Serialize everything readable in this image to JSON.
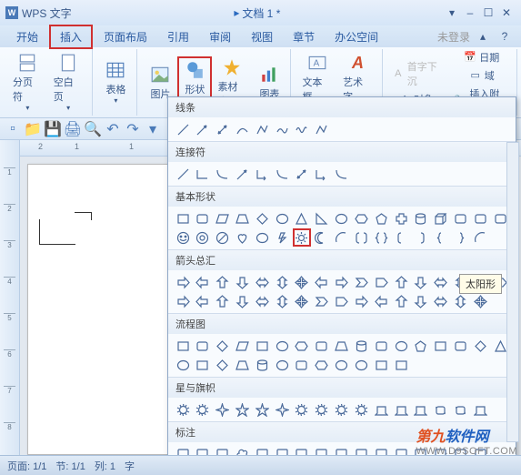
{
  "app": {
    "name": "WPS 文字",
    "icon_letter": "W",
    "doc_title": "文档 1",
    "dirty": "*"
  },
  "window_buttons": {
    "min": "–",
    "max": "☐",
    "close": "✕",
    "help": "?"
  },
  "tabs": [
    "开始",
    "插入",
    "页面布局",
    "引用",
    "审阅",
    "视图",
    "章节",
    "办公空间"
  ],
  "login_text": "未登录",
  "ribbon": {
    "page_break": "分页符",
    "blank_page": "空白页",
    "table": "表格",
    "picture": "图片",
    "shapes": "形状",
    "material": "素材库",
    "chart": "图表",
    "textbox": "文本框",
    "wordart": "艺术字",
    "dropcap": "首字下沉",
    "object": "对象",
    "date": "日期",
    "field": "域",
    "attach": "插入附件"
  },
  "shapes_panel": {
    "lines": "线条",
    "connectors": "连接符",
    "basic": "基本形状",
    "arrows": "箭头总汇",
    "flowchart": "流程图",
    "stars": "星与旗帜",
    "callouts": "标注"
  },
  "tooltip": "太阳形",
  "status": {
    "page": "页面: 1/1",
    "section": "节: 1/1",
    "col": "列: 1",
    "char": "字"
  },
  "watermark": {
    "brand1": "第九",
    "brand2": "软件网",
    "url": "WWW.D9SOFT.COM"
  }
}
